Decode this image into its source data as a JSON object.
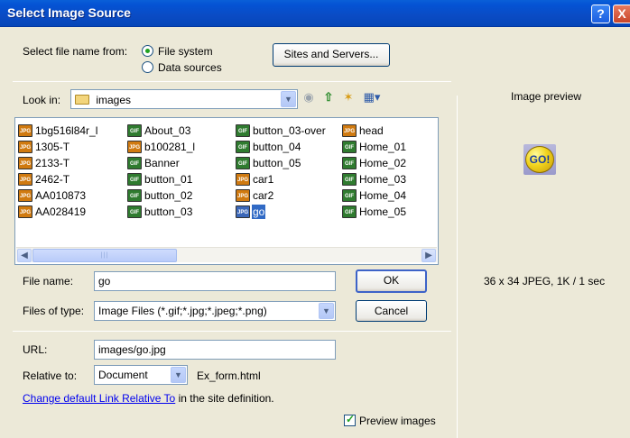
{
  "window": {
    "title": "Select Image Source",
    "help_label": "?",
    "close_label": "X"
  },
  "source": {
    "label": "Select file name from:",
    "options": [
      "File system",
      "Data sources"
    ],
    "selected": "File system",
    "sites_button": "Sites and Servers..."
  },
  "lookin": {
    "label": "Look in:",
    "folder": "images"
  },
  "files": [
    {
      "name": "1bg516l84r_l",
      "type": "JPG"
    },
    {
      "name": "1305-T",
      "type": "JPG"
    },
    {
      "name": "2133-T",
      "type": "JPG"
    },
    {
      "name": "2462-T",
      "type": "JPG"
    },
    {
      "name": "AA010873",
      "type": "JPG"
    },
    {
      "name": "AA028419",
      "type": "JPG"
    },
    {
      "name": "About_03",
      "type": "GIF"
    },
    {
      "name": "b100281_l",
      "type": "JPG"
    },
    {
      "name": "Banner",
      "type": "GIF"
    },
    {
      "name": "button_01",
      "type": "GIF"
    },
    {
      "name": "button_02",
      "type": "GIF"
    },
    {
      "name": "button_03",
      "type": "GIF"
    },
    {
      "name": "button_03-over",
      "type": "GIF"
    },
    {
      "name": "button_04",
      "type": "GIF"
    },
    {
      "name": "button_05",
      "type": "GIF"
    },
    {
      "name": "car1",
      "type": "JPG"
    },
    {
      "name": "car2",
      "type": "JPG"
    },
    {
      "name": "go",
      "type": "JPG",
      "selected": true
    },
    {
      "name": "head",
      "type": "JPG"
    },
    {
      "name": "Home_01",
      "type": "GIF"
    },
    {
      "name": "Home_02",
      "type": "GIF"
    },
    {
      "name": "Home_03",
      "type": "GIF"
    },
    {
      "name": "Home_04",
      "type": "GIF"
    },
    {
      "name": "Home_05",
      "type": "GIF"
    }
  ],
  "filename": {
    "label": "File name:",
    "value": "go"
  },
  "filetype": {
    "label": "Files of type:",
    "value": "Image Files (*.gif;*.jpg;*.jpeg;*.png)"
  },
  "buttons": {
    "ok": "OK",
    "cancel": "Cancel"
  },
  "url": {
    "label": "URL:",
    "value": "images/go.jpg"
  },
  "relative": {
    "label": "Relative to:",
    "value": "Document",
    "file": "Ex_form.html"
  },
  "link_note": {
    "link": "Change default Link Relative To",
    "rest": " in the site definition."
  },
  "preview": {
    "title": "Image preview",
    "image_text": "GO!",
    "info": "36 x 34 JPEG, 1K / 1 sec",
    "checkbox_label": "Preview images",
    "checked": true
  },
  "icons": {
    "folder": "folder-icon",
    "back": "back-icon",
    "up": "up-folder-icon",
    "new_folder": "new-folder-icon",
    "views": "view-menu-icon"
  }
}
